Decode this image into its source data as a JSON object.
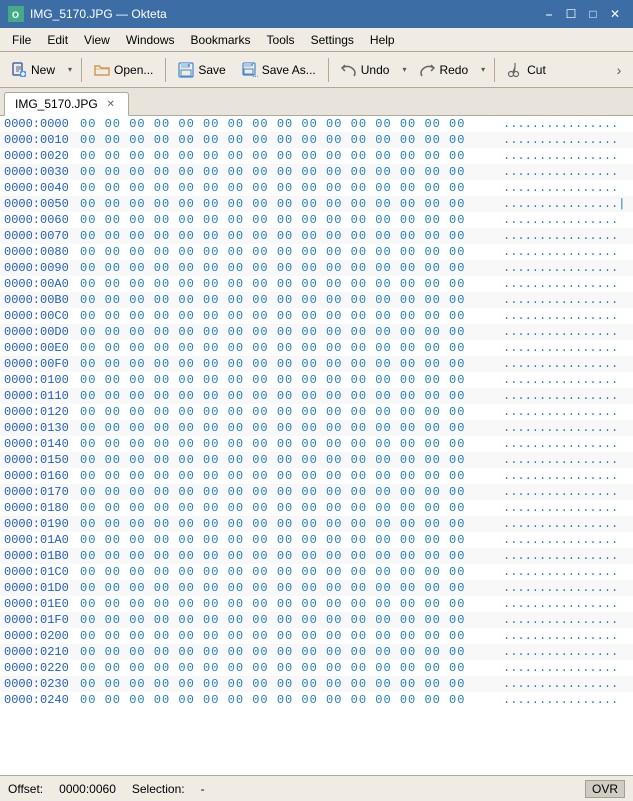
{
  "titleBar": {
    "icon": "O",
    "title": "IMG_5170.JPG — Okteta",
    "controls": {
      "minimize": "🗕",
      "maximize": "🗗",
      "close": "✕"
    }
  },
  "menuBar": {
    "items": [
      "File",
      "Edit",
      "View",
      "Windows",
      "Bookmarks",
      "Tools",
      "Settings",
      "Help"
    ]
  },
  "toolbar": {
    "new_label": "New",
    "open_label": "Open...",
    "save_label": "Save",
    "saveas_label": "Save As...",
    "undo_label": "Undo",
    "redo_label": "Redo",
    "cut_label": "Cut",
    "more": "›"
  },
  "tabBar": {
    "tabs": [
      {
        "label": "IMG_5170.JPG",
        "active": true
      }
    ]
  },
  "hexEditor": {
    "rows": [
      {
        "offset": "0000:0000",
        "bytes": "00 00 00 00  00 00 00 00  00 00 00 00  00 00 00 00",
        "ascii": "................"
      },
      {
        "offset": "0000:0010",
        "bytes": "00 00 00 00  00 00 00 00  00 00 00 00  00 00 00 00",
        "ascii": "................"
      },
      {
        "offset": "0000:0020",
        "bytes": "00 00 00 00  00 00 00 00  00 00 00 00  00 00 00 00",
        "ascii": "................"
      },
      {
        "offset": "0000:0030",
        "bytes": "00 00 00 00  00 00 00 00  00 00 00 00  00 00 00 00",
        "ascii": "................"
      },
      {
        "offset": "0000:0040",
        "bytes": "00 00 00 00  00 00 00 00  00 00 00 00  00 00 00 00",
        "ascii": "................"
      },
      {
        "offset": "0000:0050",
        "bytes": "00 00 00 00  00 00 00 00  00 00 00 00  00 00 00 00",
        "ascii": "................|"
      },
      {
        "offset": "0000:0060",
        "bytes": "00 00 00 00  00 00 00 00  00 00 00 00  00 00 00 00",
        "ascii": "................"
      },
      {
        "offset": "0000:0070",
        "bytes": "00 00 00 00  00 00 00 00  00 00 00 00  00 00 00 00",
        "ascii": "................"
      },
      {
        "offset": "0000:0080",
        "bytes": "00 00 00 00  00 00 00 00  00 00 00 00  00 00 00 00",
        "ascii": "................"
      },
      {
        "offset": "0000:0090",
        "bytes": "00 00 00 00  00 00 00 00  00 00 00 00  00 00 00 00",
        "ascii": "................"
      },
      {
        "offset": "0000:00A0",
        "bytes": "00 00 00 00  00 00 00 00  00 00 00 00  00 00 00 00",
        "ascii": "................"
      },
      {
        "offset": "0000:00B0",
        "bytes": "00 00 00 00  00 00 00 00  00 00 00 00  00 00 00 00",
        "ascii": "................"
      },
      {
        "offset": "0000:00C0",
        "bytes": "00 00 00 00  00 00 00 00  00 00 00 00  00 00 00 00",
        "ascii": "................"
      },
      {
        "offset": "0000:00D0",
        "bytes": "00 00 00 00  00 00 00 00  00 00 00 00  00 00 00 00",
        "ascii": "................"
      },
      {
        "offset": "0000:00E0",
        "bytes": "00 00 00 00  00 00 00 00  00 00 00 00  00 00 00 00",
        "ascii": "................"
      },
      {
        "offset": "0000:00F0",
        "bytes": "00 00 00 00  00 00 00 00  00 00 00 00  00 00 00 00",
        "ascii": "................"
      },
      {
        "offset": "0000:0100",
        "bytes": "00 00 00 00  00 00 00 00  00 00 00 00  00 00 00 00",
        "ascii": "................"
      },
      {
        "offset": "0000:0110",
        "bytes": "00 00 00 00  00 00 00 00  00 00 00 00  00 00 00 00",
        "ascii": "................"
      },
      {
        "offset": "0000:0120",
        "bytes": "00 00 00 00  00 00 00 00  00 00 00 00  00 00 00 00",
        "ascii": "................"
      },
      {
        "offset": "0000:0130",
        "bytes": "00 00 00 00  00 00 00 00  00 00 00 00  00 00 00 00",
        "ascii": "................"
      },
      {
        "offset": "0000:0140",
        "bytes": "00 00 00 00  00 00 00 00  00 00 00 00  00 00 00 00",
        "ascii": "................"
      },
      {
        "offset": "0000:0150",
        "bytes": "00 00 00 00  00 00 00 00  00 00 00 00  00 00 00 00",
        "ascii": "................"
      },
      {
        "offset": "0000:0160",
        "bytes": "00 00 00 00  00 00 00 00  00 00 00 00  00 00 00 00",
        "ascii": "................"
      },
      {
        "offset": "0000:0170",
        "bytes": "00 00 00 00  00 00 00 00  00 00 00 00  00 00 00 00",
        "ascii": "................"
      },
      {
        "offset": "0000:0180",
        "bytes": "00 00 00 00  00 00 00 00  00 00 00 00  00 00 00 00",
        "ascii": "................"
      },
      {
        "offset": "0000:0190",
        "bytes": "00 00 00 00  00 00 00 00  00 00 00 00  00 00 00 00",
        "ascii": "................"
      },
      {
        "offset": "0000:01A0",
        "bytes": "00 00 00 00  00 00 00 00  00 00 00 00  00 00 00 00",
        "ascii": "................"
      },
      {
        "offset": "0000:01B0",
        "bytes": "00 00 00 00  00 00 00 00  00 00 00 00  00 00 00 00",
        "ascii": "................"
      },
      {
        "offset": "0000:01C0",
        "bytes": "00 00 00 00  00 00 00 00  00 00 00 00  00 00 00 00",
        "ascii": "................"
      },
      {
        "offset": "0000:01D0",
        "bytes": "00 00 00 00  00 00 00 00  00 00 00 00  00 00 00 00",
        "ascii": "................"
      },
      {
        "offset": "0000:01E0",
        "bytes": "00 00 00 00  00 00 00 00  00 00 00 00  00 00 00 00",
        "ascii": "................"
      },
      {
        "offset": "0000:01F0",
        "bytes": "00 00 00 00  00 00 00 00  00 00 00 00  00 00 00 00",
        "ascii": "................"
      },
      {
        "offset": "0000:0200",
        "bytes": "00 00 00 00  00 00 00 00  00 00 00 00  00 00 00 00",
        "ascii": "................"
      },
      {
        "offset": "0000:0210",
        "bytes": "00 00 00 00  00 00 00 00  00 00 00 00  00 00 00 00",
        "ascii": "................"
      },
      {
        "offset": "0000:0220",
        "bytes": "00 00 00 00  00 00 00 00  00 00 00 00  00 00 00 00",
        "ascii": "................"
      },
      {
        "offset": "0000:0230",
        "bytes": "00 00 00 00  00 00 00 00  00 00 00 00  00 00 00 00",
        "ascii": "................"
      },
      {
        "offset": "0000:0240",
        "bytes": "00 00 00 00  00 00 00 00  00 00 00 00  00 00 00 00",
        "ascii": "................"
      }
    ]
  },
  "statusBar": {
    "offset_label": "Offset:",
    "offset_value": "0000:0060",
    "selection_label": "Selection:",
    "selection_value": "-",
    "ovr_label": "OVR"
  }
}
